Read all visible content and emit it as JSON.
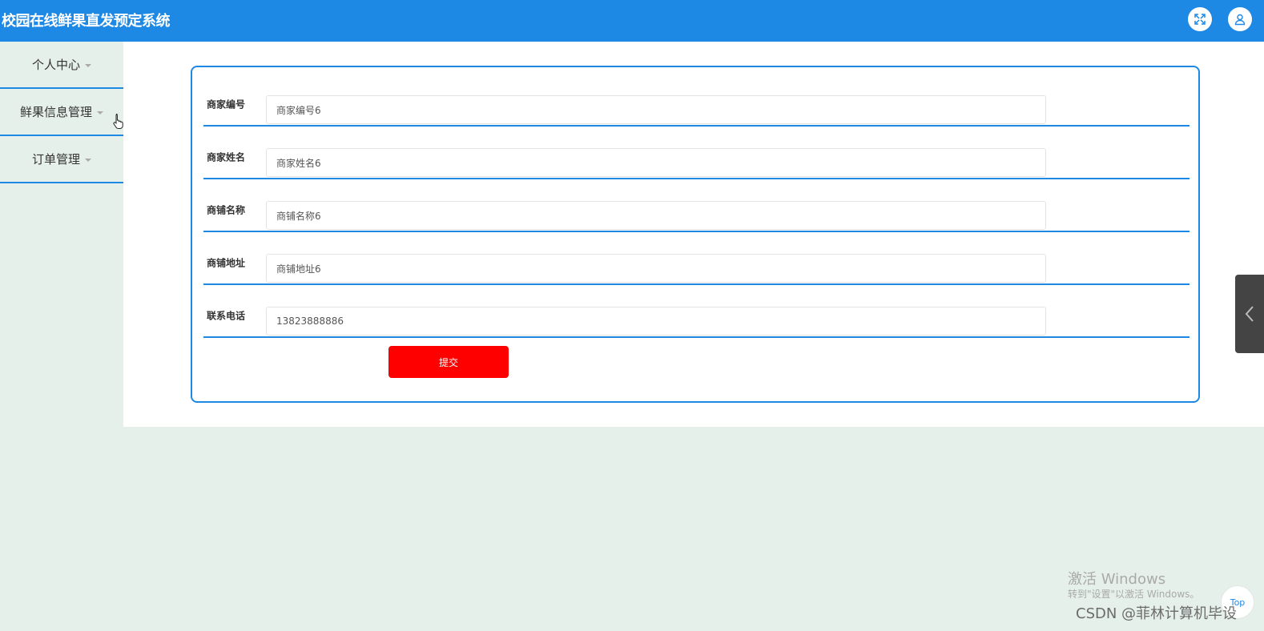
{
  "header": {
    "title": "校园在线鲜果直发预定系统",
    "fullscreen_icon": "expand-icon",
    "user_icon": "user-icon"
  },
  "sidebar": {
    "items": [
      {
        "label": "个人中心"
      },
      {
        "label": "鲜果信息管理"
      },
      {
        "label": "订单管理"
      }
    ]
  },
  "form": {
    "fields": [
      {
        "label": "商家编号",
        "value": "商家编号6"
      },
      {
        "label": "商家姓名",
        "value": "商家姓名6"
      },
      {
        "label": "商铺名称",
        "value": "商铺名称6"
      },
      {
        "label": "商铺地址",
        "value": "商铺地址6"
      },
      {
        "label": "联系电话",
        "value": "13823888886"
      }
    ],
    "submit_label": "提交"
  },
  "overlay": {
    "activation_title": "激活 Windows",
    "activation_sub": "转到\"设置\"以激活 Windows。",
    "csdn": "CSDN @菲林计算机毕设",
    "top_label": "Top"
  },
  "colors": {
    "accent": "#1e88e5",
    "submit": "#ff0000",
    "page_bg": "#e6f0eb"
  }
}
